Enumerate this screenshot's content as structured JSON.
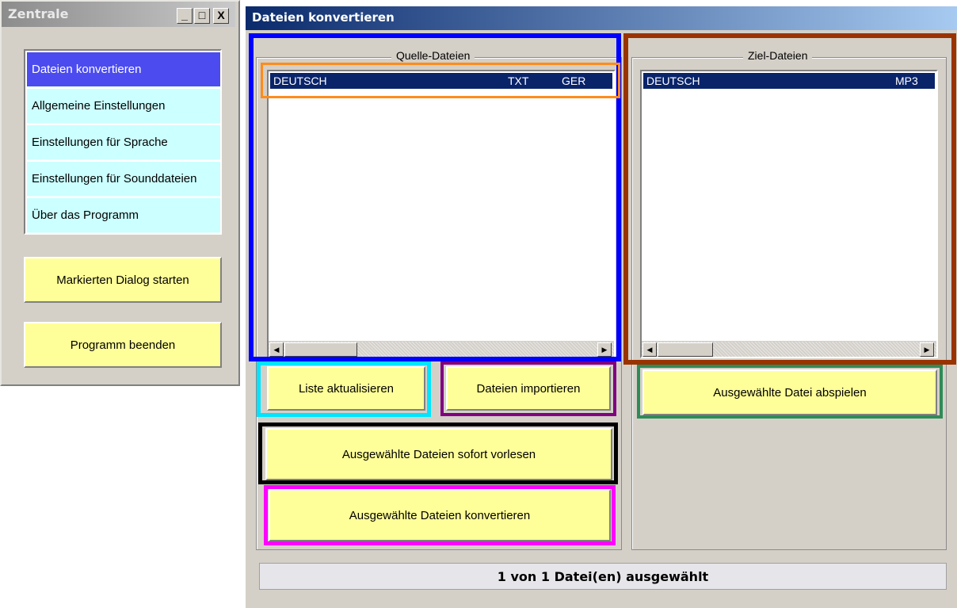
{
  "zentrale": {
    "title": "Zentrale",
    "window_buttons": {
      "minimize": "_",
      "maximize": "□",
      "close": "X"
    },
    "menu_items": [
      {
        "label": "Dateien konvertieren",
        "selected": true
      },
      {
        "label": "Allgemeine Einstellungen",
        "selected": false
      },
      {
        "label": "Einstellungen für Sprache",
        "selected": false
      },
      {
        "label": "Einstellungen für Sounddateien",
        "selected": false
      },
      {
        "label": "Über das Programm",
        "selected": false
      }
    ],
    "start_button": "Markierten Dialog starten",
    "exit_button": "Programm beenden"
  },
  "dialog": {
    "title": "Dateien konvertieren",
    "source": {
      "legend": "Quelle-Dateien",
      "rows": [
        {
          "name": "DEUTSCH",
          "type": "TXT",
          "lang": "GER"
        }
      ]
    },
    "target": {
      "legend": "Ziel-Dateien",
      "rows": [
        {
          "name": "DEUTSCH",
          "type": "MP3"
        }
      ]
    },
    "buttons": {
      "refresh": "Liste aktualisieren",
      "import": "Dateien importieren",
      "play": "Ausgewählte Datei abspielen",
      "read": "Ausgewählte Dateien sofort vorlesen",
      "convert": "Ausgewählte Dateien konvertieren"
    },
    "status": "1 von 1 Datei(en) ausgewählt"
  },
  "colors": {
    "button_yellow": "#ffff99",
    "menu_cyan": "#ccffff",
    "menu_selected": "#4b4bf0",
    "row_selected": "#0a246a",
    "highlight_source": "#0000ff",
    "highlight_row": "#ff8c1a",
    "highlight_target": "#993300",
    "highlight_refresh": "#00e5ff",
    "highlight_import": "#800080",
    "highlight_play": "#2e8b57",
    "highlight_read": "#000000",
    "highlight_convert": "#ff00ff"
  },
  "icons": {
    "scroll_left": "arrow-left-icon",
    "scroll_right": "arrow-right-icon"
  }
}
